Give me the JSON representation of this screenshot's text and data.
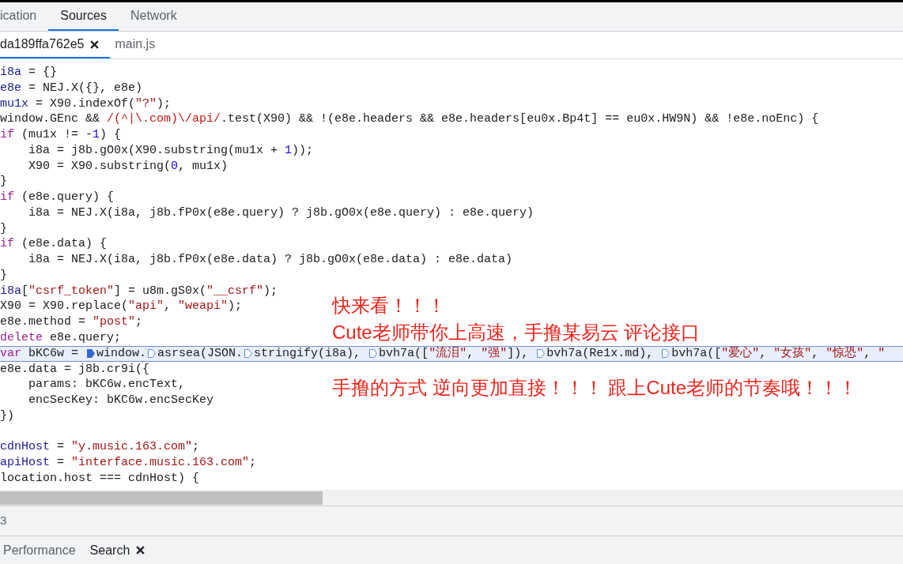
{
  "panel_tabs": [
    {
      "label": "ication",
      "selected": false
    },
    {
      "label": "Sources",
      "selected": true
    },
    {
      "label": "Network",
      "selected": false
    }
  ],
  "file_tabs": [
    {
      "label": "da189ffa762e5",
      "selected": true,
      "closable": true
    },
    {
      "label": "main.js",
      "selected": false,
      "closable": false
    }
  ],
  "code_lines": [
    {
      "highlighted": false,
      "tokens": [
        {
          "kind": "def",
          "text": "i8a"
        },
        {
          "kind": "plain",
          "text": " = {}"
        }
      ]
    },
    {
      "highlighted": false,
      "tokens": [
        {
          "kind": "def",
          "text": "e8e"
        },
        {
          "kind": "plain",
          "text": " = NEJ.X({}, e8e)"
        }
      ]
    },
    {
      "highlighted": false,
      "tokens": [
        {
          "kind": "def",
          "text": "mu1x"
        },
        {
          "kind": "plain",
          "text": " = X90.indexOf("
        },
        {
          "kind": "string",
          "text": "\"?\""
        },
        {
          "kind": "plain",
          "text": ");"
        }
      ]
    },
    {
      "highlighted": false,
      "tokens": [
        {
          "kind": "plain",
          "text": "window.GEnc && "
        },
        {
          "kind": "regex",
          "text": "/(^|\\.com)\\/api/"
        },
        {
          "kind": "plain",
          "text": ".test(X90) && !(e8e.headers && e8e.headers[eu0x.Bp4t] == eu0x.HW9N) && !e8e.noEnc) {"
        }
      ]
    },
    {
      "highlighted": false,
      "tokens": [
        {
          "kind": "keyword",
          "text": "if"
        },
        {
          "kind": "plain",
          "text": " (mu1x != -"
        },
        {
          "kind": "number",
          "text": "1"
        },
        {
          "kind": "plain",
          "text": ") {"
        }
      ]
    },
    {
      "highlighted": false,
      "tokens": [
        {
          "kind": "plain",
          "text": "    i8a = j8b.gO0x(X90.substring(mu1x + "
        },
        {
          "kind": "number",
          "text": "1"
        },
        {
          "kind": "plain",
          "text": "));"
        }
      ]
    },
    {
      "highlighted": false,
      "tokens": [
        {
          "kind": "plain",
          "text": "    X90 = X90.substring("
        },
        {
          "kind": "number",
          "text": "0"
        },
        {
          "kind": "plain",
          "text": ", mu1x)"
        }
      ]
    },
    {
      "highlighted": false,
      "tokens": [
        {
          "kind": "plain",
          "text": "}"
        }
      ]
    },
    {
      "highlighted": false,
      "tokens": [
        {
          "kind": "keyword",
          "text": "if"
        },
        {
          "kind": "plain",
          "text": " (e8e.query) {"
        }
      ]
    },
    {
      "highlighted": false,
      "tokens": [
        {
          "kind": "plain",
          "text": "    i8a = NEJ.X(i8a, j8b.fP0x(e8e.query) ? j8b.gO0x(e8e.query) : e8e.query)"
        }
      ]
    },
    {
      "highlighted": false,
      "tokens": [
        {
          "kind": "plain",
          "text": "}"
        }
      ]
    },
    {
      "highlighted": false,
      "tokens": [
        {
          "kind": "keyword",
          "text": "if"
        },
        {
          "kind": "plain",
          "text": " (e8e.data) {"
        }
      ]
    },
    {
      "highlighted": false,
      "tokens": [
        {
          "kind": "plain",
          "text": "    i8a = NEJ.X(i8a, j8b.fP0x(e8e.data) ? j8b.gO0x(e8e.data) : e8e.data)"
        }
      ]
    },
    {
      "highlighted": false,
      "tokens": [
        {
          "kind": "plain",
          "text": "}"
        }
      ]
    },
    {
      "highlighted": false,
      "tokens": [
        {
          "kind": "def",
          "text": "i8a"
        },
        {
          "kind": "plain",
          "text": "["
        },
        {
          "kind": "string",
          "text": "\"csrf_token\""
        },
        {
          "kind": "plain",
          "text": "] = u8m.gS0x("
        },
        {
          "kind": "string",
          "text": "\"__csrf\""
        },
        {
          "kind": "plain",
          "text": ");"
        }
      ]
    },
    {
      "highlighted": false,
      "tokens": [
        {
          "kind": "plain",
          "text": "X90 = X90.replace("
        },
        {
          "kind": "string",
          "text": "\"api\""
        },
        {
          "kind": "plain",
          "text": ", "
        },
        {
          "kind": "string",
          "text": "\"weapi\""
        },
        {
          "kind": "plain",
          "text": ");"
        }
      ]
    },
    {
      "highlighted": false,
      "tokens": [
        {
          "kind": "plain",
          "text": "e8e.method = "
        },
        {
          "kind": "string",
          "text": "\"post\""
        },
        {
          "kind": "plain",
          "text": ";"
        }
      ]
    },
    {
      "highlighted": false,
      "tokens": [
        {
          "kind": "keyword",
          "text": "delete"
        },
        {
          "kind": "plain",
          "text": " e8e.query;"
        }
      ]
    },
    {
      "highlighted": true,
      "tokens": [
        {
          "kind": "keyword",
          "text": "var"
        },
        {
          "kind": "plain",
          "text": " bKC6w = "
        },
        {
          "kind": "marker",
          "active": true
        },
        {
          "kind": "plain",
          "text": "window."
        },
        {
          "kind": "marker",
          "active": false
        },
        {
          "kind": "plain",
          "text": "asrsea(JSON."
        },
        {
          "kind": "marker",
          "active": false
        },
        {
          "kind": "plain",
          "text": "stringify(i8a), "
        },
        {
          "kind": "marker",
          "active": false
        },
        {
          "kind": "plain",
          "text": "bvh7a(["
        },
        {
          "kind": "string",
          "text": "\"流泪\""
        },
        {
          "kind": "plain",
          "text": ", "
        },
        {
          "kind": "string",
          "text": "\"强\""
        },
        {
          "kind": "plain",
          "text": "]), "
        },
        {
          "kind": "marker",
          "active": false
        },
        {
          "kind": "plain",
          "text": "bvh7a(Re1x.md), "
        },
        {
          "kind": "marker",
          "active": false
        },
        {
          "kind": "plain",
          "text": "bvh7a(["
        },
        {
          "kind": "string",
          "text": "\"爱心\""
        },
        {
          "kind": "plain",
          "text": ", "
        },
        {
          "kind": "string",
          "text": "\"女孩\""
        },
        {
          "kind": "plain",
          "text": ", "
        },
        {
          "kind": "string",
          "text": "\"惊恐\""
        },
        {
          "kind": "plain",
          "text": ", "
        },
        {
          "kind": "string",
          "text": "\""
        }
      ]
    },
    {
      "highlighted": false,
      "tokens": [
        {
          "kind": "plain",
          "text": "e8e.data = j8b.cr9i({"
        }
      ]
    },
    {
      "highlighted": false,
      "tokens": [
        {
          "kind": "plain",
          "text": "    params: bKC6w.encText,"
        }
      ]
    },
    {
      "highlighted": false,
      "tokens": [
        {
          "kind": "plain",
          "text": "    encSecKey: bKC6w.encSecKey"
        }
      ]
    },
    {
      "highlighted": false,
      "tokens": [
        {
          "kind": "plain",
          "text": "})"
        }
      ]
    },
    {
      "highlighted": false
    },
    {
      "highlighted": false,
      "tokens": [
        {
          "kind": "def",
          "text": "cdnHost"
        },
        {
          "kind": "plain",
          "text": " = "
        },
        {
          "kind": "string",
          "text": "\"y.music.163.com\""
        },
        {
          "kind": "plain",
          "text": ";"
        }
      ]
    },
    {
      "highlighted": false,
      "tokens": [
        {
          "kind": "def",
          "text": "apiHost"
        },
        {
          "kind": "plain",
          "text": " = "
        },
        {
          "kind": "string",
          "text": "\"interface.music.163.com\""
        },
        {
          "kind": "plain",
          "text": ";"
        }
      ]
    },
    {
      "highlighted": false,
      "tokens": [
        {
          "kind": "plain",
          "text": "location.host === cdnHost) {"
        }
      ]
    }
  ],
  "annotations": [
    "快来看！！！",
    "Cute老师带你上高速，手撸某易云 评论接口",
    "手撸的方式 逆向更加直接！！！ 跟上Cute老师的节奏哦！！！"
  ],
  "status_text": "3",
  "drawer_tabs": [
    {
      "label": "Performance",
      "selected": false,
      "closable": false
    },
    {
      "label": "Search",
      "selected": true,
      "closable": true
    }
  ]
}
